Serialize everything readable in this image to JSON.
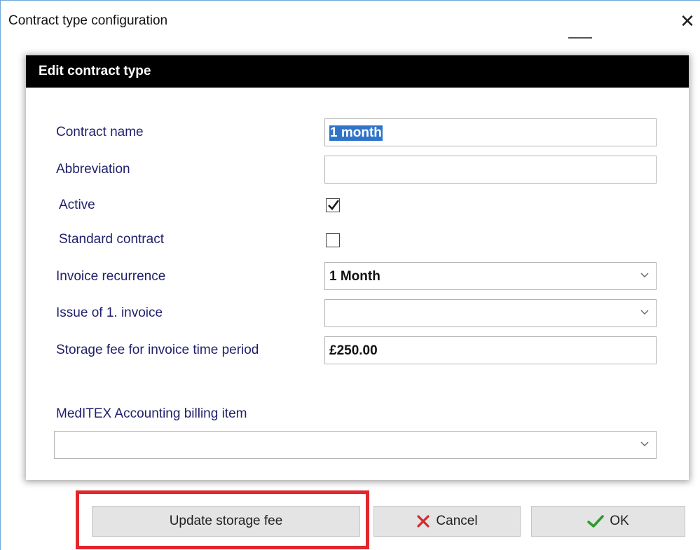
{
  "window": {
    "title": "Contract type configuration"
  },
  "panel": {
    "header": "Edit contract type"
  },
  "form": {
    "contract_name": {
      "label": "Contract name",
      "value": "1 month"
    },
    "abbreviation": {
      "label": "Abbreviation",
      "value": ""
    },
    "active": {
      "label": "Active",
      "checked": true
    },
    "standard_contract": {
      "label": "Standard contract",
      "checked": false
    },
    "invoice_recurrence": {
      "label": "Invoice recurrence",
      "value": "1 Month"
    },
    "issue_first_invoice": {
      "label": "Issue of 1. invoice",
      "value": ""
    },
    "storage_fee": {
      "label": "Storage fee for invoice time period",
      "value": "£250.00"
    },
    "billing_item": {
      "label": "MedITEX Accounting billing item",
      "value": ""
    }
  },
  "buttons": {
    "update_storage_fee": "Update storage fee",
    "cancel": "Cancel",
    "ok": "OK"
  },
  "icons": {
    "close": "close-icon",
    "checkmark": "checkmark-icon",
    "dropdown": "chevron-down-icon",
    "cancel": "red-x-icon",
    "ok": "green-check-icon"
  },
  "colors": {
    "header_bg": "#000000",
    "label_text": "#1f1f6b",
    "selection": "#2f74c9",
    "highlight_border": "#e3262c",
    "ok_check": "#2e9a2e",
    "cancel_x": "#d42a2a"
  }
}
